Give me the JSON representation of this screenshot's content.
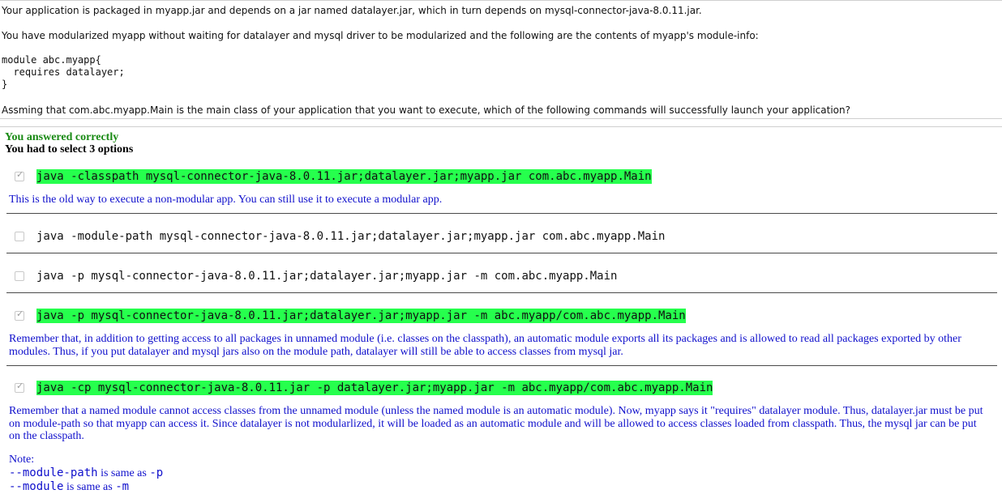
{
  "question": {
    "line1": "Your application is packaged in myapp.jar and depends on a jar named datalayer.jar, which in turn depends on mysql-connector-java-8.0.11.jar.",
    "line2": "You have modularized myapp without waiting for datalayer and mysql driver to be modularized and the following are the contents of myapp's module-info:",
    "code": "module abc.myapp{\n  requires datalayer;\n}",
    "line3": "Assming that com.abc.myapp.Main is the main class of your application that you want to execute, which of the following commands will successfully launch your application?"
  },
  "result": {
    "status": "You answered correctly",
    "requirement": "You had to select 3 options"
  },
  "options": [
    {
      "command": "java -classpath mysql-connector-java-8.0.11.jar;datalayer.jar;myapp.jar com.abc.myapp.Main",
      "checked": true,
      "explanation": "This is the old way to execute a non-modular app. You can still use it to execute a modular app."
    },
    {
      "command": "java -module-path mysql-connector-java-8.0.11.jar;datalayer.jar;myapp.jar com.abc.myapp.Main",
      "checked": false
    },
    {
      "command": "java -p mysql-connector-java-8.0.11.jar;datalayer.jar;myapp.jar -m com.abc.myapp.Main",
      "checked": false
    },
    {
      "command": "java -p mysql-connector-java-8.0.11.jar;datalayer.jar;myapp.jar -m abc.myapp/com.abc.myapp.Main",
      "checked": true,
      "explanation": "Remember that, in addition to getting access to all packages in unnamed module (i.e. classes on the classpath), an automatic module exports all its packages and is allowed to read all packages exported by other modules. Thus, if you put datalayer and mysql jars also on the module path, datalayer will still be able to access classes from mysql jar."
    },
    {
      "command": "java -cp mysql-connector-java-8.0.11.jar -p datalayer.jar;myapp.jar -m abc.myapp/com.abc.myapp.Main",
      "checked": true,
      "explanation": "Remember that a named module cannot access classes from the unnamed module (unless the named module is an automatic module). Now, myapp says it \"requires\" datalayer module. Thus, datalayer.jar must be put on module-path so that myapp can access it. Since datalayer is not modularlized, it will be loaded as an automatic module and will be allowed to access classes loaded from classpath. Thus, the mysql jar can be put on the classpath."
    }
  ],
  "note": {
    "title": "Note:",
    "line1_code": "--module-path",
    "line1_mid": " is same as ",
    "line1_end": "-p",
    "line2_code": "--module",
    "line2_mid": " is same as ",
    "line2_end": "-m"
  },
  "icons": {
    "checkbox_check": "check-icon"
  },
  "colors": {
    "highlight": "#26ff4d",
    "explanation": "#1010cc",
    "correct": "#198a14"
  }
}
